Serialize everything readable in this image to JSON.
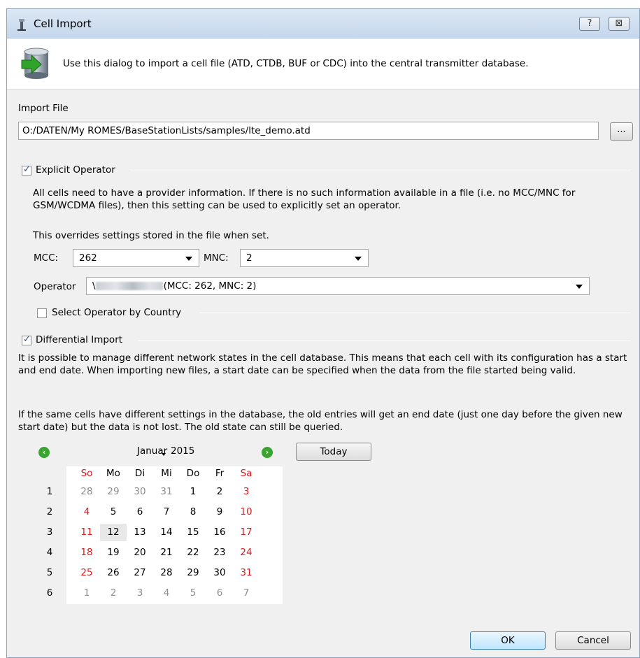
{
  "window": {
    "title": "Cell Import",
    "help_glyph": "?",
    "close_glyph": "⊠"
  },
  "banner": {
    "text": "Use this dialog to import a cell file (ATD, CTDB, BUF or CDC) into the central transmitter database."
  },
  "import_file": {
    "label": "Import File",
    "path": "O:/DATEN/My ROMES/BaseStationLists/samples/lte_demo.atd",
    "browse_label": "..."
  },
  "explicit_operator": {
    "label": "Explicit Operator",
    "checked": true,
    "description": "All cells need to have a provider information. If there is no such information available in a file (i.e. no MCC/MNC for GSM/WCDMA files), then this setting can be used to explicitly set an operator.",
    "override_note": "This overrides settings stored in the file when set.",
    "mcc_label": "MCC:",
    "mcc_value": "262",
    "mnc_label": "MNC:",
    "mnc_value": "2",
    "operator_label": "Operator",
    "operator_prefix": "\\",
    "operator_value": "(MCC: 262, MNC: 2)"
  },
  "select_by_country": {
    "label": "Select Operator by Country",
    "checked": false
  },
  "differential_import": {
    "label": "Differential Import",
    "checked": true,
    "paragraph1": "It is possible to manage different network states in the cell database. This means that each cell with its configuration has a start and end date. When importing new files, a start date can be specified when the data from the file started being valid.",
    "paragraph2": "If the same cells have different settings in the database, the old entries will get an end date (just one day before the given new start date) but the data is not lost. The old state can still be queried."
  },
  "calendar": {
    "month": "Januar",
    "year": "2015",
    "prev_glyph": "‹",
    "next_glyph": "›",
    "today_label": "Today",
    "weekdays": [
      "So",
      "Mo",
      "Di",
      "Mi",
      "Do",
      "Fr",
      "Sa"
    ],
    "weeks": [
      {
        "week": "1",
        "days": [
          "28",
          "29",
          "30",
          "31",
          "1",
          "2",
          "3"
        ]
      },
      {
        "week": "2",
        "days": [
          "4",
          "5",
          "6",
          "7",
          "8",
          "9",
          "10"
        ]
      },
      {
        "week": "3",
        "days": [
          "11",
          "12",
          "13",
          "14",
          "15",
          "16",
          "17"
        ]
      },
      {
        "week": "4",
        "days": [
          "18",
          "19",
          "20",
          "21",
          "22",
          "23",
          "24"
        ]
      },
      {
        "week": "5",
        "days": [
          "25",
          "26",
          "27",
          "28",
          "29",
          "30",
          "31"
        ]
      },
      {
        "week": "6",
        "days": [
          "1",
          "2",
          "3",
          "4",
          "5",
          "6",
          "7"
        ]
      }
    ],
    "selected_day": "12"
  },
  "buttons": {
    "ok": "OK",
    "cancel": "Cancel"
  },
  "colors": {
    "weekend": "#e0191c",
    "other_month": "#8e8e8e",
    "nav_green": "#3aa52e"
  },
  "icons": {
    "title": "cell-tower-icon",
    "banner": "database-import-icon"
  }
}
